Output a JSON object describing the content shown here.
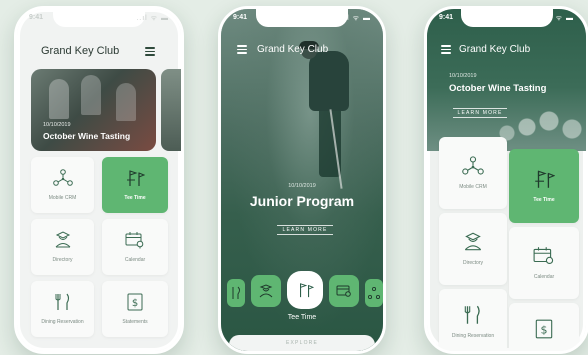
{
  "status_bar": {
    "time": "9:41",
    "icons": "..ıl ᯤ ▬"
  },
  "phone1": {
    "header_title": "Grand Key Club",
    "event": {
      "date": "10/10/2019",
      "title": "October Wine Tasting"
    },
    "tiles": [
      {
        "label": "Mobile CRM",
        "icon": "network-icon",
        "active": false
      },
      {
        "label": "Tee Time",
        "icon": "golf-flag-icon",
        "active": true
      },
      {
        "label": "Directory",
        "icon": "directory-icon",
        "active": false
      },
      {
        "label": "Calendar",
        "icon": "calendar-icon",
        "active": false
      },
      {
        "label": "Dining Reservation",
        "icon": "fork-knife-icon",
        "active": false
      },
      {
        "label": "Statements",
        "icon": "statement-icon",
        "active": false
      }
    ]
  },
  "phone2": {
    "header_title": "Grand Key Club",
    "date": "10/10/2019",
    "event_title": "Junior Program",
    "learn_more": "LEARN MORE",
    "carousel_label": "Tee Time",
    "explore": "EXPLORE"
  },
  "phone3": {
    "header_title": "Grand Key Club",
    "date": "10/10/2019",
    "event_title": "October Wine Tasting",
    "learn_more": "LEARN MORE",
    "tiles": [
      {
        "label": "Mobile CRM",
        "active": false
      },
      {
        "label": "Tee Time",
        "active": true
      },
      {
        "label": "Directory",
        "active": false
      },
      {
        "label": "Calendar",
        "active": false
      },
      {
        "label": "Dining Reservation",
        "active": false
      },
      {
        "label": "",
        "active": false
      }
    ]
  },
  "colors": {
    "accent": "#5fb672",
    "dark_green": "#2a5c47",
    "background": "#e4ede6"
  }
}
